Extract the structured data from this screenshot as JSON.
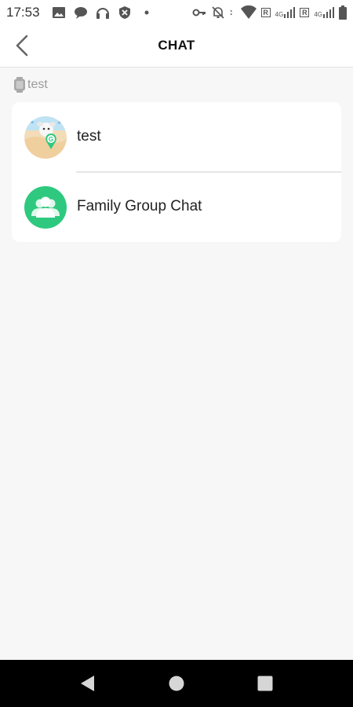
{
  "status_bar": {
    "time": "17:53",
    "network_badge_1": "R",
    "network_type_1": "4G",
    "network_badge_2": "R",
    "network_type_2": "4G"
  },
  "header": {
    "title": "CHAT"
  },
  "device": {
    "label": "test"
  },
  "chats": [
    {
      "label": "test",
      "avatar": "child-avatar"
    },
    {
      "label": "Family Group Chat",
      "avatar": "group-icon"
    }
  ],
  "colors": {
    "accent_green": "#2ec97f",
    "background": "#f7f7f7",
    "card": "#ffffff"
  }
}
